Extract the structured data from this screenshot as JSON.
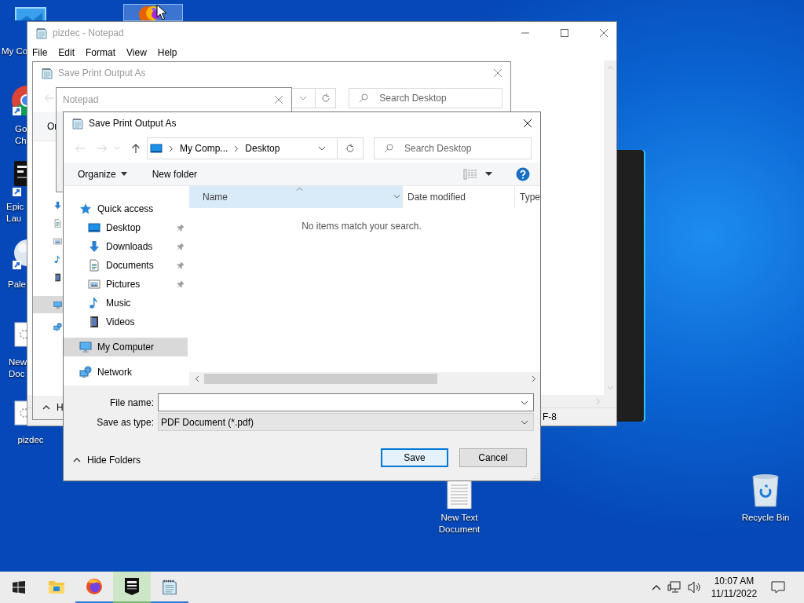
{
  "desktop_icons": [
    {
      "kind": "computer",
      "lines": [
        "My Co"
      ],
      "selected": false
    },
    {
      "kind": "chrome",
      "lines": [
        "Go",
        "Ch"
      ],
      "selected": false
    },
    {
      "kind": "epic",
      "lines": [
        "Epic",
        "Lau"
      ],
      "selected": false
    },
    {
      "kind": "palemoon",
      "lines": [
        "Pale"
      ],
      "selected": false
    },
    {
      "kind": "document",
      "lines": [
        "New",
        "Doc"
      ],
      "selected": false
    },
    {
      "kind": "document",
      "lines": [
        "pizdec"
      ],
      "selected": false
    },
    {
      "kind": "textfile",
      "lines": [
        "New Text",
        "Document"
      ],
      "selected": false
    },
    {
      "kind": "recyclebin",
      "lines": [
        "Recycle Bin"
      ],
      "selected": false
    },
    {
      "kind": "firefox",
      "selected": true
    }
  ],
  "notepad": {
    "title": "pizdec - Notepad",
    "menu": [
      "File",
      "Edit",
      "Format",
      "View",
      "Help"
    ],
    "status": "F-8"
  },
  "back_dialog": {
    "title": "Save Print Output As",
    "search": {
      "placeholder": "Search Desktop"
    },
    "toolbar_text": "Or",
    "hide_folders": "H"
  },
  "message_box": {
    "title": "Notepad"
  },
  "dialog": {
    "title": "Save Print Output As",
    "path": [
      "My Comp...",
      "Desktop"
    ],
    "search": {
      "placeholder": "Search Desktop"
    },
    "organize": "Organize",
    "new_folder": "New folder",
    "nav": [
      {
        "label": "Quick access",
        "kind": "star",
        "selected": false,
        "children": [
          {
            "label": "Desktop",
            "kind": "desktop",
            "pinned": true,
            "selected": false
          },
          {
            "label": "Downloads",
            "kind": "downloads",
            "pinned": true,
            "selected": false
          },
          {
            "label": "Documents",
            "kind": "documents",
            "pinned": true,
            "selected": false
          },
          {
            "label": "Pictures",
            "kind": "pictures",
            "pinned": true,
            "selected": false
          },
          {
            "label": "Music",
            "kind": "music",
            "pinned": false,
            "selected": false
          },
          {
            "label": "Videos",
            "kind": "videos",
            "pinned": false,
            "selected": false
          }
        ]
      },
      {
        "label": "My Computer",
        "kind": "computer",
        "selected": true
      },
      {
        "label": "Network",
        "kind": "network",
        "selected": false
      }
    ],
    "columns": [
      {
        "label": "Name",
        "sorted": true,
        "hovered": true
      },
      {
        "label": "Date modified",
        "sorted": false,
        "hovered": false
      },
      {
        "label": "Type",
        "sorted": false,
        "hovered": false
      }
    ],
    "empty_message": "No items match your search.",
    "file_name": {
      "label": "File name:"
    },
    "save_as_type": {
      "label": "Save as type:",
      "value": "PDF Document (*.pdf)"
    },
    "hide_folders": "Hide Folders",
    "buttons": [
      {
        "label": "Save",
        "default": true
      },
      {
        "label": "Cancel",
        "default": false
      }
    ]
  },
  "taskbar": {
    "apps": [
      {
        "kind": "explorer",
        "running": false,
        "active": false
      },
      {
        "kind": "firefox",
        "running": true,
        "active": false
      },
      {
        "kind": "epic",
        "running": true,
        "active": true
      },
      {
        "kind": "notepad",
        "running": true,
        "active": false
      }
    ],
    "time": "10:07 AM",
    "date": "11/11/2022"
  }
}
